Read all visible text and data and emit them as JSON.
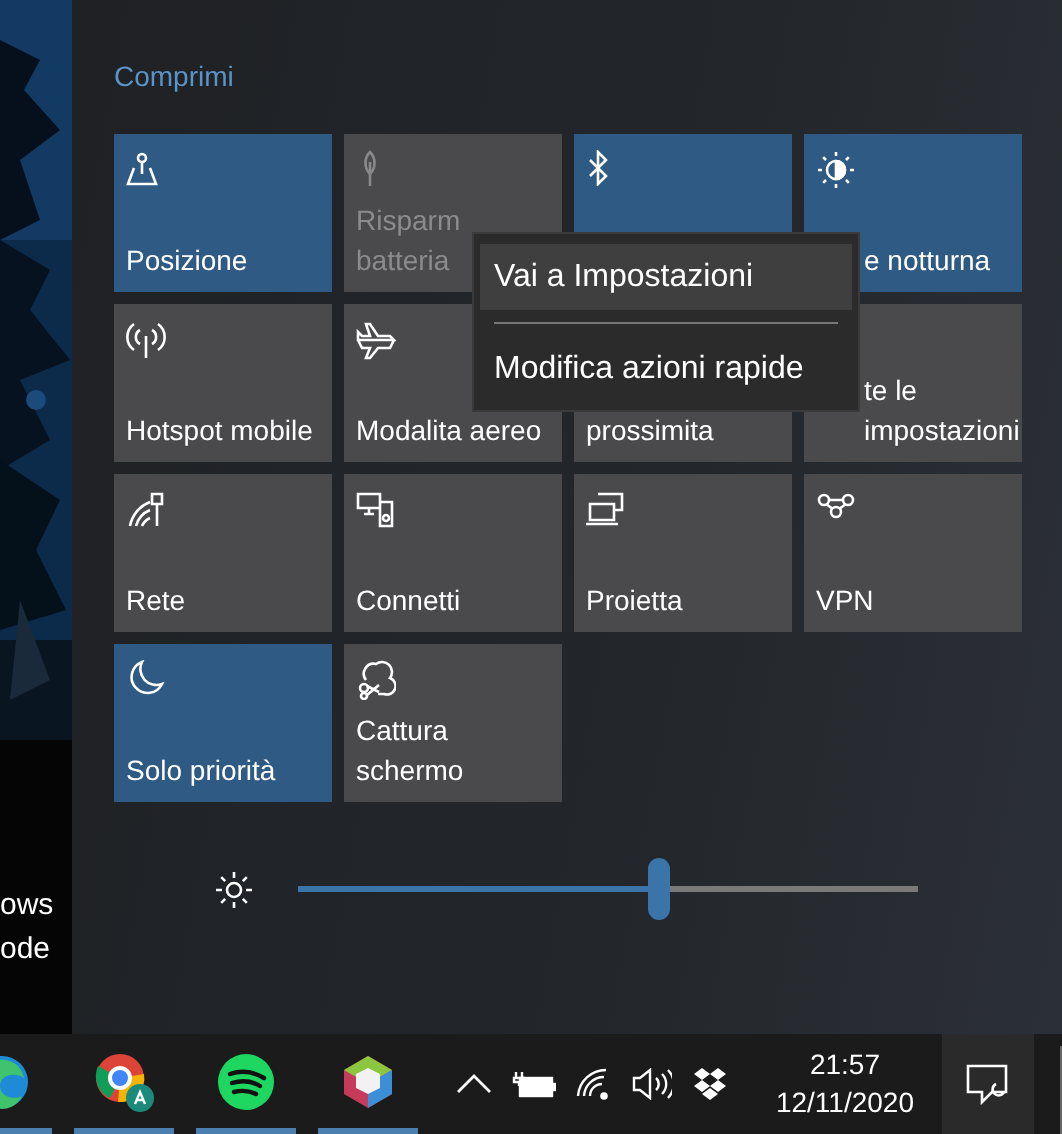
{
  "desktop": {
    "window_text": [
      "ows",
      "ode"
    ]
  },
  "action_center": {
    "collapse_link": "Comprimi",
    "tiles": [
      {
        "label": "Posizione",
        "on": true,
        "disabled": false
      },
      {
        "label": "Risparm\nbatteria",
        "on": false,
        "disabled": true
      },
      {
        "on": true,
        "disabled": false
      },
      {
        "label": "e notturna",
        "on": true,
        "disabled": false
      },
      {
        "label": "Hotspot mobile",
        "on": false,
        "disabled": false
      },
      {
        "label": "Modalita aereo",
        "on": false,
        "disabled": false
      },
      {
        "label": "prossimita",
        "on": false,
        "disabled": false
      },
      {
        "label": "te le\nimpostazioni",
        "on": false,
        "disabled": false
      },
      {
        "label": "Rete",
        "on": false,
        "disabled": false
      },
      {
        "label": "Connetti",
        "on": false,
        "disabled": false
      },
      {
        "label": "Proietta",
        "on": false,
        "disabled": false
      },
      {
        "label": "VPN",
        "on": false,
        "disabled": false
      },
      {
        "label": "Solo priorità",
        "on": true,
        "disabled": false
      },
      {
        "label": "Cattura\nschermo",
        "on": false,
        "disabled": false
      }
    ],
    "brightness": {
      "level": 0.58
    }
  },
  "context_menu": {
    "items": [
      {
        "label": "Vai a Impostazioni",
        "selected": true
      },
      {
        "label": "Modifica azioni rapide",
        "selected": false
      }
    ]
  },
  "taskbar": {
    "clock": {
      "time": "21:57",
      "date": "12/11/2020"
    }
  }
}
